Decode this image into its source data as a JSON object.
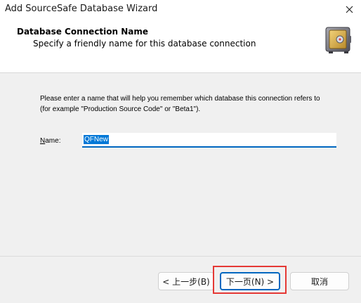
{
  "window": {
    "title": "Add SourceSafe Database Wizard",
    "close_glyph": "✕"
  },
  "header": {
    "title": "Database Connection Name",
    "subtitle": "Specify a friendly name for this database connection",
    "icon": "safe-icon"
  },
  "body": {
    "description": "Please enter a name that will help you remember which database this connection refers to (for example \"Production Source Code\" or \"Beta1\").",
    "name_label_prefix": "N",
    "name_label_rest": "ame:",
    "name_value": "QFNew"
  },
  "buttons": {
    "back_label": "< 上一步(B)",
    "next_label": "下一页(N) >",
    "cancel_label": "取消"
  },
  "colors": {
    "accent": "#0067c0",
    "selection": "#0078d7",
    "highlight_box": "#e53935"
  }
}
